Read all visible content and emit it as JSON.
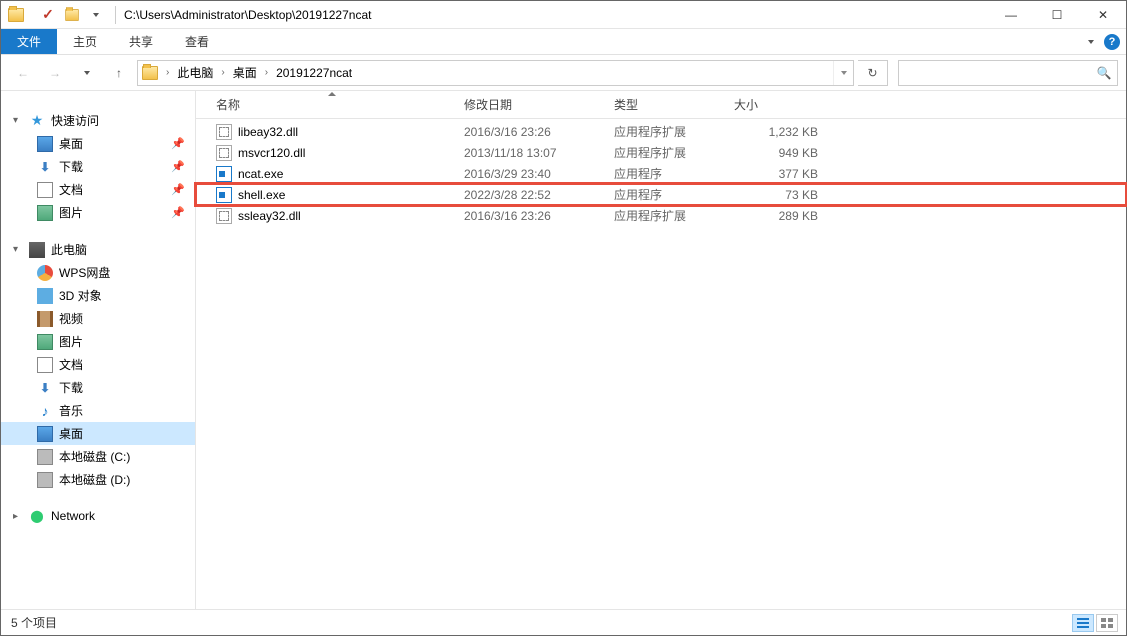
{
  "title_path": "C:\\Users\\Administrator\\Desktop\\20191227ncat",
  "ribbon": {
    "file": "文件",
    "tabs": [
      "主页",
      "共享",
      "查看"
    ]
  },
  "breadcrumb": [
    "此电脑",
    "桌面",
    "20191227ncat"
  ],
  "columns": {
    "name": "名称",
    "date": "修改日期",
    "type": "类型",
    "size": "大小"
  },
  "sidebar": {
    "quick": {
      "label": "快速访问",
      "items": [
        {
          "label": "桌面",
          "icon": "desktop",
          "pin": true
        },
        {
          "label": "下载",
          "icon": "download",
          "pin": true
        },
        {
          "label": "文档",
          "icon": "doc",
          "pin": true
        },
        {
          "label": "图片",
          "icon": "pic",
          "pin": true
        }
      ]
    },
    "pc": {
      "label": "此电脑",
      "items": [
        {
          "label": "WPS网盘",
          "icon": "wps"
        },
        {
          "label": "3D 对象",
          "icon": "3d"
        },
        {
          "label": "视频",
          "icon": "video"
        },
        {
          "label": "图片",
          "icon": "pic"
        },
        {
          "label": "文档",
          "icon": "doc"
        },
        {
          "label": "下载",
          "icon": "download"
        },
        {
          "label": "音乐",
          "icon": "music"
        },
        {
          "label": "桌面",
          "icon": "desktop",
          "selected": true
        },
        {
          "label": "本地磁盘 (C:)",
          "icon": "disk"
        },
        {
          "label": "本地磁盘 (D:)",
          "icon": "disk"
        }
      ]
    },
    "network": {
      "label": "Network"
    }
  },
  "files": [
    {
      "name": "libeay32.dll",
      "date": "2016/3/16 23:26",
      "type": "应用程序扩展",
      "size": "1,232 KB",
      "icon": "dll"
    },
    {
      "name": "msvcr120.dll",
      "date": "2013/11/18 13:07",
      "type": "应用程序扩展",
      "size": "949 KB",
      "icon": "dll"
    },
    {
      "name": "ncat.exe",
      "date": "2016/3/29 23:40",
      "type": "应用程序",
      "size": "377 KB",
      "icon": "exe"
    },
    {
      "name": "shell.exe",
      "date": "2022/3/28 22:52",
      "type": "应用程序",
      "size": "73 KB",
      "icon": "exe",
      "highlight": true
    },
    {
      "name": "ssleay32.dll",
      "date": "2016/3/16 23:26",
      "type": "应用程序扩展",
      "size": "289 KB",
      "icon": "dll"
    }
  ],
  "status": "5 个项目"
}
